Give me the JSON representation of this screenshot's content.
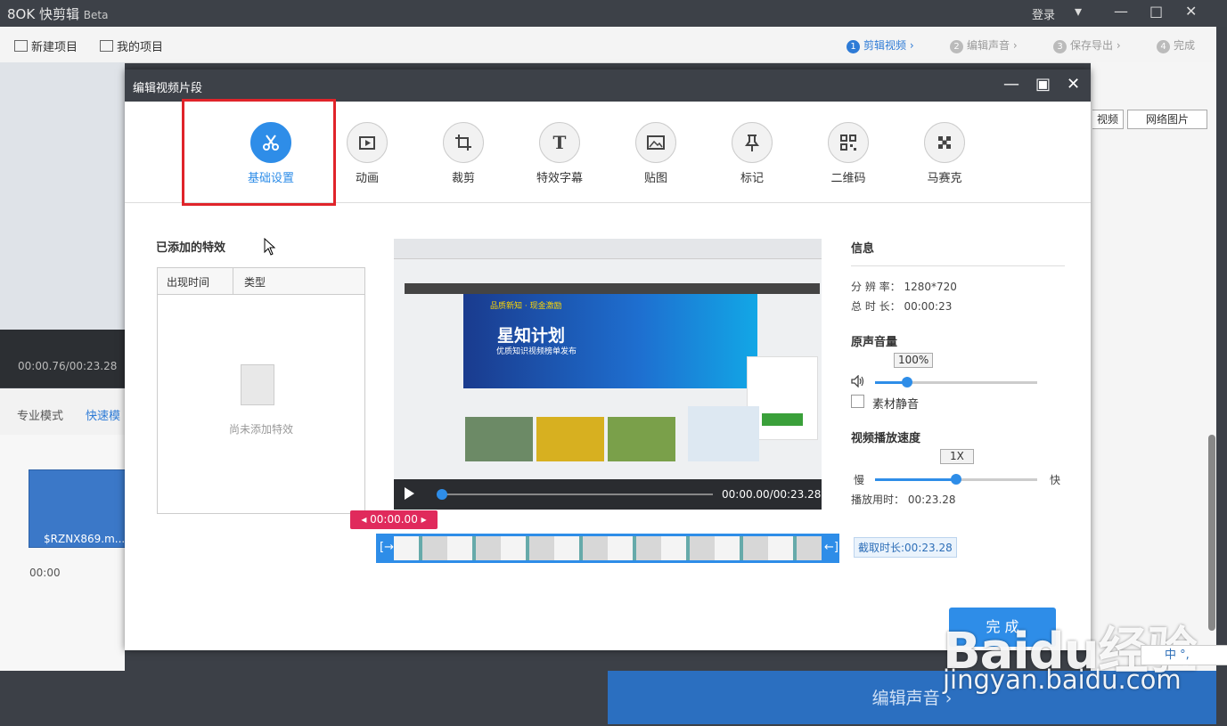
{
  "app": {
    "logo": "8OK 快剪辑",
    "beta": "Beta",
    "login": "登录",
    "new_project": "新建项目",
    "my_projects": "我的项目",
    "steps": [
      {
        "num": "1",
        "label": "剪辑视频"
      },
      {
        "num": "2",
        "label": "编辑声音"
      },
      {
        "num": "3",
        "label": "保存导出"
      },
      {
        "num": "4",
        "label": "完成"
      }
    ],
    "bg_time": "00:00.76/00:23.28",
    "mode_pro": "专业模式",
    "mode_fast": "快速模",
    "clip_name": "$RZNX869.m...",
    "timeline_zero": "00:00",
    "local_video_btn": "视频",
    "net_image_btn": "网络图片",
    "next_button": "编辑声音 ›"
  },
  "dialog": {
    "title": "编辑视频片段",
    "tabs": [
      {
        "label": "基础设置",
        "icon": "scissors-icon"
      },
      {
        "label": "动画",
        "icon": "animation-icon"
      },
      {
        "label": "裁剪",
        "icon": "crop-icon"
      },
      {
        "label": "特效字幕",
        "icon": "text-icon"
      },
      {
        "label": "贴图",
        "icon": "image-icon"
      },
      {
        "label": "标记",
        "icon": "pin-icon"
      },
      {
        "label": "二维码",
        "icon": "qrcode-icon"
      },
      {
        "label": "马赛克",
        "icon": "mosaic-icon"
      }
    ],
    "added_effects_title": "已添加的特效",
    "table_headers": [
      "出现时间",
      "类型"
    ],
    "empty_text": "尚未添加特效",
    "video": {
      "banner_title": "星知计划",
      "banner_sub1": "品质新知 · 现金激励",
      "banner_sub2": "优质知识视频榜单发布",
      "time": "00:00.00/00:23.28",
      "progress": 0
    },
    "marker_time": "00:00.00",
    "cut_duration": "截取时长:00:23.28",
    "info": {
      "title": "信息",
      "resolution_label": "分 辨 率：",
      "resolution": "1280*720",
      "duration_label": "总 时 长：",
      "duration": "00:00:23"
    },
    "volume": {
      "title": "原声音量",
      "value": "100%",
      "level": 0.2,
      "mute_label": "素材静音"
    },
    "speed": {
      "title": "视频播放速度",
      "value": "1X",
      "slow": "慢",
      "fast": "快",
      "level": 0.5,
      "play_time_label": "播放用时：",
      "play_time": "00:23.28"
    },
    "finish": "完 成"
  },
  "watermark": {
    "brand": "Baidu经验",
    "url": "jingyan.baidu.com"
  },
  "ime": "中 °,"
}
